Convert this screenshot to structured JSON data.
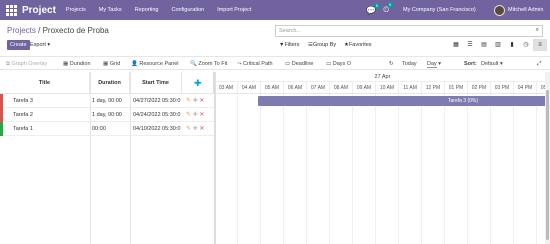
{
  "topbar": {
    "brand": "Project",
    "menu": [
      "Projects",
      "My Tasks",
      "Reporting",
      "Configuration",
      "Import Project"
    ],
    "chat_count": "5",
    "activity_count": "5",
    "company": "My Company (San Francisco)",
    "user": "Mitchell Admin"
  },
  "breadcrumb": {
    "parent": "Projects",
    "sep": " / ",
    "current": "Proxecto de Proba"
  },
  "search": {
    "placeholder": "Search..."
  },
  "actions": {
    "create": "Create",
    "export": "Export ▾"
  },
  "filters": {
    "filters": "Filters",
    "group_by": "Group By",
    "favorites": "Favorites"
  },
  "toolbar": {
    "graph_overlay": "Graph Overlay",
    "duration": "Duration",
    "grid": "Grid",
    "resource_panel": "Resource Panel",
    "zoom_to_fit": "Zoom To Fit",
    "critical_path": "Critical Path",
    "deadline": "Deadline",
    "days_o": "Days O",
    "today": "Today",
    "scale": "Day",
    "sort_label": "Sort:",
    "sort_value": "Default"
  },
  "columns": {
    "title": "Title",
    "duration": "Duration",
    "start_time": "Start Time"
  },
  "rows": [
    {
      "title": "Tarefa 3",
      "duration": "1 day, 00:00",
      "start": "04/27/2022 05:30:0",
      "color": "#d9534f"
    },
    {
      "title": "Tarefa 2",
      "duration": "1 day, 00:00",
      "start": "04/24/2022 05:30:0",
      "color": "#d9534f"
    },
    {
      "title": "Tarefa 1",
      "duration": "00:00",
      "start": "04/10/2022 05:30:0",
      "color": "#28a745"
    }
  ],
  "gantt": {
    "date": "27 Apr",
    "hours": [
      "03 AM",
      "04 AM",
      "05 AM",
      "06 AM",
      "07 AM",
      "08 AM",
      "09 AM",
      "10 AM",
      "11 AM",
      "12 PM",
      "01 PM",
      "02 PM",
      "03 PM",
      "04 PM",
      "05 PM"
    ],
    "task_bar_label": "Tarefa 3 (0%)"
  },
  "colors": {
    "brand": "#71639e",
    "bar": "#7e7bb0"
  }
}
